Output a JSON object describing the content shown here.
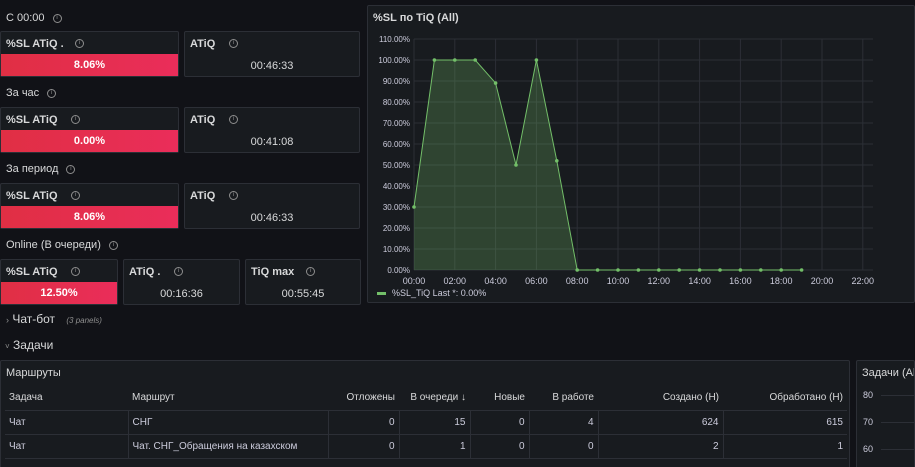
{
  "sections": {
    "s1": "С 00:00",
    "s2": "За час",
    "s3": "За период",
    "s4": "Online (В очереди)"
  },
  "stats": {
    "r1_sl_title": "%SL ATiQ .",
    "r1_sl_value": "8.06%",
    "r1_sl_level": 8.06,
    "r1_atiq_title": "ATiQ",
    "r1_atiq_value": "00:46:33",
    "r2_sl_title": "%SL ATiQ",
    "r2_sl_value": "0.00%",
    "r2_sl_level": 0.0,
    "r2_atiq_title": "ATiQ",
    "r2_atiq_value": "00:41:08",
    "r3_sl_title": "%SL ATiQ",
    "r3_sl_value": "8.06%",
    "r3_sl_level": 8.06,
    "r3_atiq_title": "ATiQ",
    "r3_atiq_value": "00:46:33",
    "r4_sl_title": "%SL ATiQ",
    "r4_sl_value": "12.50%",
    "r4_sl_level": 12.5,
    "r4_atiq_title": "ATiQ .",
    "r4_atiq_value": "00:16:36",
    "r4_tiq_title": "TiQ max",
    "r4_tiq_value": "00:55:45"
  },
  "chart_panel_title": "%SL по TiQ (All)",
  "chart_data": {
    "type": "area",
    "title": "%SL по TiQ (All)",
    "x": [
      "00:00",
      "01:00",
      "02:00",
      "03:00",
      "04:00",
      "05:00",
      "06:00",
      "07:00",
      "08:00",
      "09:00",
      "10:00",
      "11:00",
      "12:00",
      "13:00",
      "14:00",
      "15:00",
      "16:00",
      "17:00",
      "18:00",
      "19:00"
    ],
    "x_ticks": [
      "00:00",
      "02:00",
      "04:00",
      "06:00",
      "08:00",
      "10:00",
      "12:00",
      "14:00",
      "16:00",
      "18:00",
      "20:00",
      "22:00"
    ],
    "y_ticks": [
      "0.00%",
      "10.00%",
      "20.00%",
      "30.00%",
      "40.00%",
      "50.00%",
      "60.00%",
      "70.00%",
      "80.00%",
      "90.00%",
      "100.00%",
      "110.00%"
    ],
    "ylim": [
      0,
      110
    ],
    "xlim_hours": [
      0,
      22.5
    ],
    "series": [
      {
        "name": "%SL_TiQ",
        "values": [
          30,
          100,
          100,
          100,
          89,
          50,
          100,
          52,
          0,
          0,
          0,
          0,
          0,
          0,
          0,
          0,
          0,
          0,
          0,
          0
        ],
        "color": "#73bf69"
      }
    ],
    "legend": {
      "label": "%SL_TiQ",
      "last": "Last *: 0.00%",
      "placement": "bottom-left"
    },
    "grid": true
  },
  "rows": {
    "chatbot": "Чат-бот",
    "chatbot_count": "(3 panels)",
    "tasks": "Задачи"
  },
  "table": {
    "title": "Маршруты",
    "headers": [
      "Задача",
      "Маршрут",
      "Отложены",
      "В очереди",
      "Новые",
      "В работе",
      "Создано (Н)",
      "Обработано (Н)"
    ],
    "sort_indicator": "↓",
    "rows": [
      [
        "Чат",
        "СНГ",
        "0",
        "15",
        "0",
        "4",
        "624",
        "615"
      ],
      [
        "Чат",
        "Чат. СНГ_Обращения на казахском",
        "0",
        "1",
        "0",
        "0",
        "2",
        "1"
      ]
    ]
  },
  "side_panel": {
    "title": "Задачи (All",
    "ticks": [
      "80",
      "70",
      "60"
    ]
  },
  "colors": {
    "background": "#111217",
    "panel": "#181b1f",
    "bar_red": "#e02f44",
    "series_green": "#73bf69"
  }
}
